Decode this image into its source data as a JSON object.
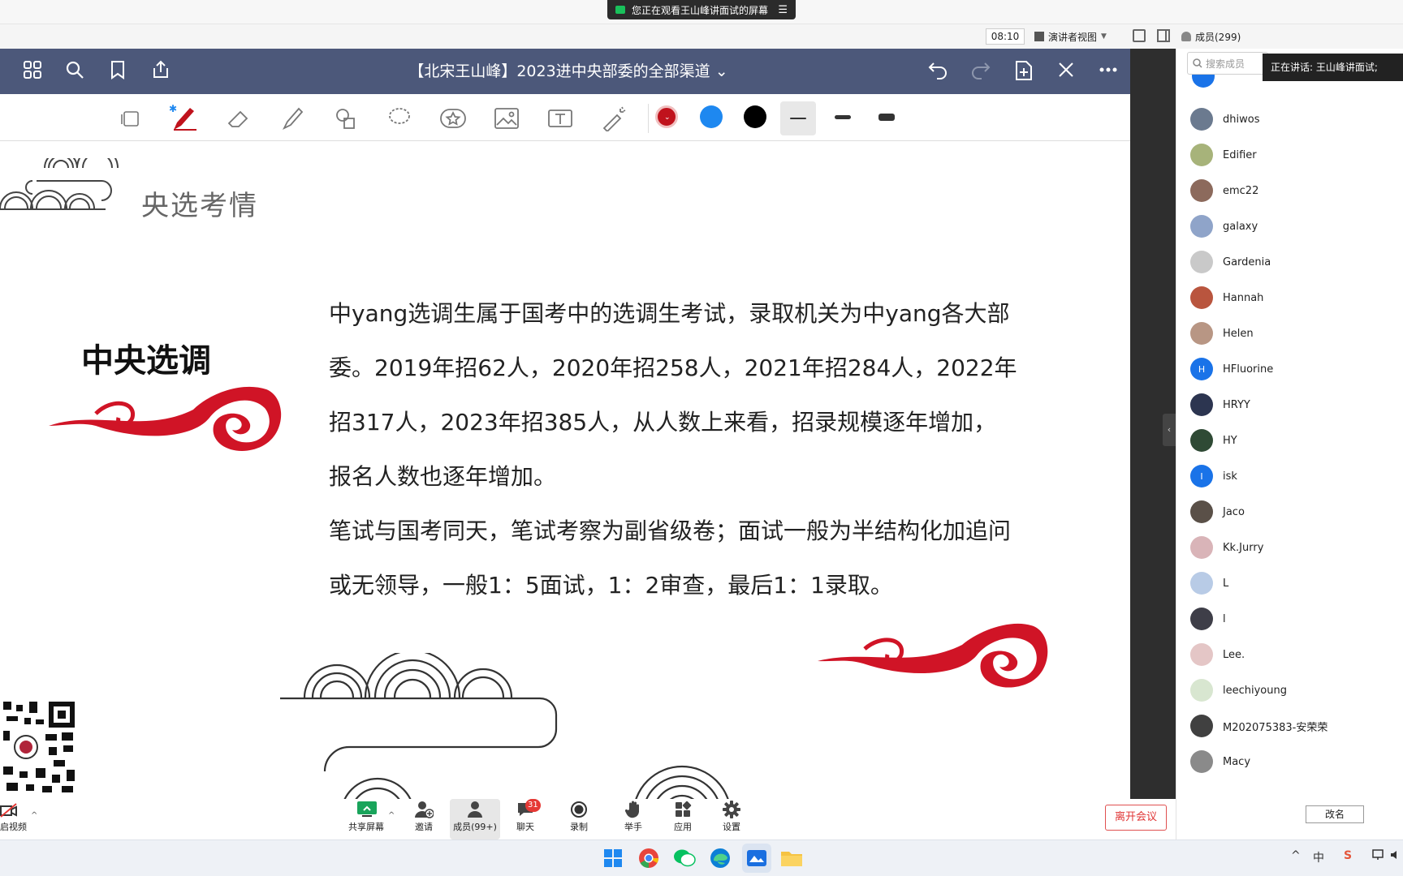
{
  "share_banner": {
    "text": "您正在观看王山峰讲面试的屏幕",
    "menu_icon": "menu-icon"
  },
  "meeting_bar": {
    "timer": "08:10",
    "view_mode": "演讲者视图",
    "members": "成员(299)"
  },
  "app": {
    "doc_title": "【北宋王山峰】2023进中央部委的全部渠道 ⌄"
  },
  "toolbar": {
    "colors": [
      "#c0121c",
      "#1e88f0",
      "#000000"
    ]
  },
  "slide": {
    "section_title": "央选考情",
    "left_heading": "中央选调",
    "paragraphs": [
      "中yang选调生属于国考中的选调生考试，录取机关为中yang各大部委。2019年招62人，2020年招258人，2021年招284人，2022年招317人，2023年招385人，从人数上来看，招录规模逐年增加，报名人数也逐年增加。",
      "笔试与国考同天，笔试考察为副省级卷；面试一般为半结构化加追问或无领导，一般1：5面试，1：2审查，最后1：1录取。"
    ]
  },
  "panel": {
    "search_placeholder": "搜索成员",
    "speaking": "正在讲话: 王山峰讲面试;",
    "members": [
      {
        "name": "dhiwos",
        "color": "#6b7a8f",
        "initial": ""
      },
      {
        "name": "Edifier",
        "color": "#a7b37a",
        "initial": ""
      },
      {
        "name": "emc22",
        "color": "#8c6a5c",
        "initial": ""
      },
      {
        "name": "galaxy",
        "color": "#8fa4c9",
        "initial": ""
      },
      {
        "name": "Gardenia",
        "color": "#c9c9c9",
        "initial": ""
      },
      {
        "name": "Hannah",
        "color": "#b9553e",
        "initial": ""
      },
      {
        "name": "Helen",
        "color": "#b89684",
        "initial": ""
      },
      {
        "name": "HFluorine",
        "color": "#1a73e8",
        "initial": "H"
      },
      {
        "name": "HRYY",
        "color": "#2c3550",
        "initial": ""
      },
      {
        "name": "HY",
        "color": "#2f4a35",
        "initial": ""
      },
      {
        "name": "isk",
        "color": "#1a73e8",
        "initial": "I"
      },
      {
        "name": "Jaco",
        "color": "#5a5048",
        "initial": ""
      },
      {
        "name": "Kk.Jurry",
        "color": "#d9b4b8",
        "initial": ""
      },
      {
        "name": "L",
        "color": "#b8cbe6",
        "initial": ""
      },
      {
        "name": "l",
        "color": "#3e3e48",
        "initial": ""
      },
      {
        "name": "Lee.",
        "color": "#e4c6c6",
        "initial": ""
      },
      {
        "name": "leechiyoung",
        "color": "#d8e6d0",
        "initial": ""
      },
      {
        "name": "M202075383-安荣荣",
        "color": "#404040",
        "initial": ""
      },
      {
        "name": "Macy",
        "color": "#8a8a8a",
        "initial": ""
      }
    ],
    "rename": "改名"
  },
  "controls": {
    "video": "启视频",
    "share": "共享屏幕",
    "invite": "邀请",
    "members": "成员(99+)",
    "chat": "聊天",
    "chat_badge": "31",
    "record": "录制",
    "raise_hand": "举手",
    "apps": "应用",
    "settings": "设置",
    "leave": "离开会议"
  },
  "taskbar": {
    "ime": "中"
  }
}
